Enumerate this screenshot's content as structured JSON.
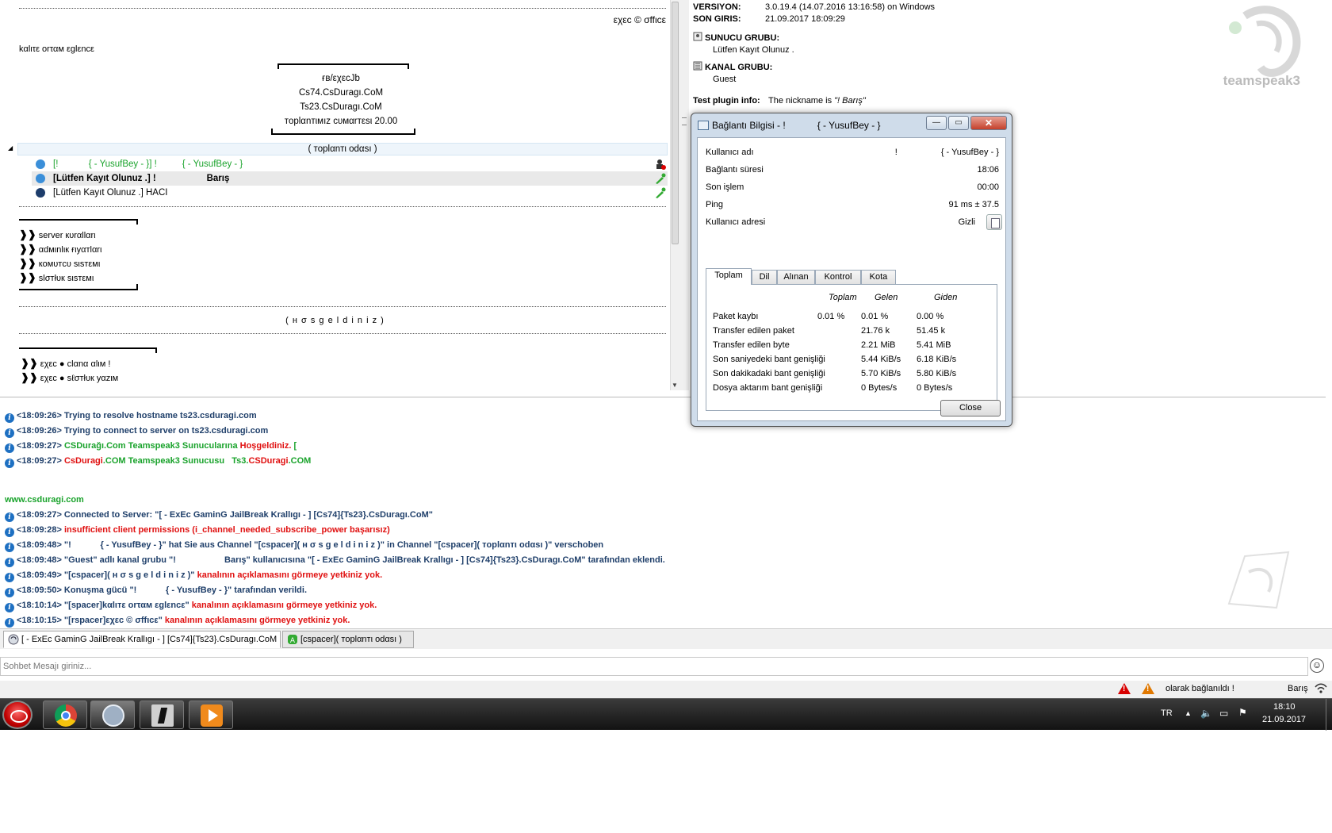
{
  "tree": {
    "top_right_text": "εχεc © σffιcε",
    "tagline": "kαlιτε οrταм εglεncε",
    "center_lines": [
      "ғв/εχεcJb",
      "Cs74.CsDuragı.CoM",
      "Ts23.CsDuragı.CoM",
      "тoplαnтιмız cυмαrтεsι 20.00"
    ],
    "channel_name": "( тoplαnтι odαsı )",
    "clients": [
      {
        "name": "[!            { - YusufBey - }] !          { - YusufBey - }",
        "dot_color": "#3b8fd9",
        "text_color": "#1aa32c",
        "bold": false
      },
      {
        "name": "[Lütfen Kayıt Olunuz .] !                    Barış",
        "dot_color": "#3b8fd9",
        "text_color": "#000000",
        "bold": true
      },
      {
        "name": "[Lütfen Kayıt Olunuz .] HACI",
        "dot_color": "#1d3d6b",
        "text_color": "#000000",
        "bold": false
      }
    ],
    "links_a": [
      "server кυrαllαrι",
      "αdмιnlιк ғιyαтlαrι",
      "кoмυтcυ sιsтεмι",
      "slσтłυк sιsтεмι"
    ],
    "welcome": "( н σ s g e l d i n i z )",
    "links_b": [
      "εχεc ● clαnα αlιм !",
      "εχεc ● sℓσтłυк yαzιм"
    ]
  },
  "info": {
    "version_label": "VERSIYON:",
    "version_value": "3.0.19.4 (14.07.2016 13:16:58) on Windows",
    "lastlogin_label": "SON GIRIS:",
    "lastlogin_value": "21.09.2017 18:09:29",
    "server_group_label": "SUNUCU GRUBU:",
    "server_group_value": "Lütfen Kayıt Olunuz .",
    "channel_group_label": "KANAL GRUBU:",
    "channel_group_value": "Guest",
    "plugin_label": "Test plugin info:",
    "plugin_value_prefix": "The nickname is",
    "plugin_value_name": "\"! Barış\"",
    "logo_text": "teamspeak3"
  },
  "dialog": {
    "title": "Bağlantı Bilgisi - !            { - YusufBey - }",
    "minimize": "—",
    "maximize": "▭",
    "close_x": "✕",
    "rows": [
      {
        "k": "Kullanıcı adı",
        "v": "!                  { - YusufBey - }"
      },
      {
        "k": "Bağlantı süresi",
        "v": "18:06"
      },
      {
        "k": "Son işlem",
        "v": "00:00"
      },
      {
        "k": "Ping",
        "v": "91 ms ± 37.5"
      },
      {
        "k": "Kullanıcı adresi",
        "v": "Gizli"
      }
    ],
    "tabs": [
      "Toplam",
      "Dil",
      "Alınan",
      "Kontrol",
      "Kota"
    ],
    "stat_headers": [
      "Toplam",
      "Gelen",
      "Giden"
    ],
    "stats": [
      {
        "label": "Paket kaybı",
        "total": "0.01 %",
        "in": "0.01 %",
        "out": "0.00 %"
      },
      {
        "label": "Transfer edilen paket",
        "total": "",
        "in": "21.76 k",
        "out": "51.45 k"
      },
      {
        "label": "Transfer edilen byte",
        "total": "",
        "in": "2.21 MiB",
        "out": "5.41 MiB"
      },
      {
        "label": "Son saniyedeki bant genişliği",
        "total": "",
        "in": "5.44 KiB/s",
        "out": "6.18 KiB/s"
      },
      {
        "label": "Son dakikadaki bant genişliği",
        "total": "",
        "in": "5.70 KiB/s",
        "out": "5.80 KiB/s"
      },
      {
        "label": "Dosya aktarım bant genişliği",
        "total": "",
        "in": "0 Bytes/s",
        "out": "0 Bytes/s"
      }
    ],
    "close_label": "Close"
  },
  "chat": {
    "lines": [
      {
        "icon": true,
        "parts": [
          {
            "t": "<18:09:26> Trying to resolve hostname ts23.csduragi.com",
            "c": "navy"
          }
        ]
      },
      {
        "icon": true,
        "parts": [
          {
            "t": "<18:09:26> Trying to connect to server on ts23.csduragi.com",
            "c": "navy"
          }
        ]
      },
      {
        "icon": true,
        "parts": [
          {
            "t": "<18:09:27> ",
            "c": "navy"
          },
          {
            "t": "CSDurağı.Com Teamspeak3 Sunucularına ",
            "c": "green"
          },
          {
            "t": "Hoşgeldiniz.",
            "c": "red"
          },
          {
            "t": " [",
            "c": "green"
          }
        ]
      },
      {
        "icon": true,
        "parts": [
          {
            "t": "<18:09:27> ",
            "c": "navy"
          },
          {
            "t": "CsDuragi",
            "c": "red"
          },
          {
            "t": ".COM Teamspeak3 Sunucusu   Ts3.",
            "c": "green"
          },
          {
            "t": "CSDuragi",
            "c": "red"
          },
          {
            "t": ".COM",
            "c": "green"
          }
        ]
      },
      {
        "icon": false,
        "parts": [
          {
            "t": "",
            "c": "navy"
          }
        ]
      },
      {
        "icon": false,
        "parts": [
          {
            "t": "www.csduragi.com",
            "c": "green"
          }
        ]
      },
      {
        "icon": true,
        "parts": [
          {
            "t": "<18:09:27> Connected to Server: \"[ - ExEc GaminG JailBreak Krallıgı - ] [Cs74]{Ts23}.CsDuragı.CoM\"",
            "c": "navy"
          }
        ]
      },
      {
        "icon": true,
        "parts": [
          {
            "t": "<18:09:28> ",
            "c": "navy"
          },
          {
            "t": "insufficient client permissions (i_channel_needed_subscribe_power başarısız)",
            "c": "red"
          }
        ]
      },
      {
        "icon": true,
        "parts": [
          {
            "t": "<18:09:48> \"!            { - YusufBey - }\" hat Sie aus Channel \"[cspacer]( н σ s g e l d i n i z )\" in Channel \"[cspacer]( тoplαnтι odαsı )\" verschoben",
            "c": "navy"
          }
        ]
      },
      {
        "icon": true,
        "parts": [
          {
            "t": "<18:09:48> \"Guest\" adlı kanal grubu \"!                    Barış\" kullanıcısına \"[ - ExEc GaminG JailBreak Krallıgı - ] [Cs74]{Ts23}.CsDuragı.CoM\" tarafından eklendi.",
            "c": "navy"
          }
        ]
      },
      {
        "icon": true,
        "parts": [
          {
            "t": "<18:09:49> \"[cspacer]( н σ s g e l d i n i z )\" ",
            "c": "navy"
          },
          {
            "t": "kanalının açıklamasını görmeye yetkiniz yok.",
            "c": "red"
          }
        ]
      },
      {
        "icon": true,
        "parts": [
          {
            "t": "<18:09:50> Konuşma gücü \"!            { - YusufBey - }\" tarafından verildi.",
            "c": "navy"
          }
        ]
      },
      {
        "icon": true,
        "parts": [
          {
            "t": "<18:10:14> \"[spacer]kαlιтε οrταм εglεncε\" ",
            "c": "navy"
          },
          {
            "t": "kanalının açıklamasını görmeye yetkiniz yok.",
            "c": "red"
          }
        ]
      },
      {
        "icon": true,
        "parts": [
          {
            "t": "<18:10:15> \"[rspacer]εχεc © σffιcε\" ",
            "c": "navy"
          },
          {
            "t": "kanalının açıklamasını görmeye yetkiniz yok.",
            "c": "red"
          }
        ]
      }
    ]
  },
  "tabstrip": {
    "server_tab": "[ - ExEc GaminG JailBreak Krallıgı - ] [Cs74]{Ts23}.CsDuragı.CoM",
    "channel_tab": "[cspacer]( тoplαnтι odαsı )"
  },
  "input": {
    "placeholder": "Sohbet Mesajı giriniz..."
  },
  "statusbar": {
    "connected_text": "olarak bağlanıldı !",
    "nickname": "Barış",
    "warn_color_1": "#d80000",
    "warn_color_2": "#e07800"
  },
  "taskbar": {
    "lang": "TR",
    "time": "18:10",
    "date": "21.09.2017",
    "apps": [
      "chrome-icon",
      "teamspeak-icon",
      "counter-strike-icon",
      "media-player-icon"
    ]
  },
  "colors": {
    "accent": "#1f3f6a",
    "green": "#1aa32c",
    "red": "#e01010"
  }
}
